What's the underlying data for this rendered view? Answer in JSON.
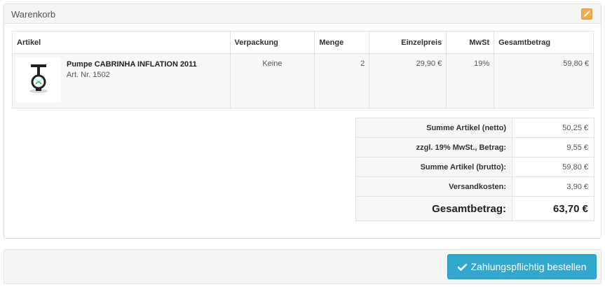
{
  "panel": {
    "title": "Warenkorb",
    "edit_icon": "pencil-icon",
    "accent": "#f0ad4e"
  },
  "columns": [
    "Artikel",
    "Verpackung",
    "Menge",
    "Einzelpreis",
    "MwSt",
    "Gesamtbetrag"
  ],
  "items": [
    {
      "name": "Pumpe CABRINHA INFLATION 2011",
      "art_nr": "Art. Nr. 1502",
      "packaging": "Keine",
      "quantity": "2",
      "unit_price": "29,90 €",
      "tax": "19%",
      "total": "59,80 €"
    }
  ],
  "totals": {
    "net_label": "Summe Artikel (netto)",
    "net_value": "50,25 €",
    "vat_label": "zzgl. 19% MwSt., Betrag:",
    "vat_value": "9,55 €",
    "gross_label": "Summe Artikel (brutto):",
    "gross_value": "59,80 €",
    "shipping_label": "Versandkosten:",
    "shipping_value": "3,90 €",
    "grand_label": "Gesamtbetrag:",
    "grand_value": "63,70 €"
  },
  "footer": {
    "order_label": "Zahlungspflichtig bestellen",
    "order_icon": "checkmark-icon",
    "button_color": "#31a8cc"
  }
}
